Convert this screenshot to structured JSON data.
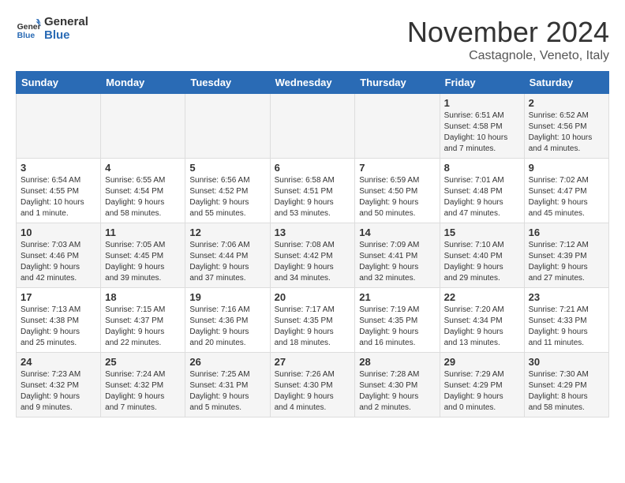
{
  "header": {
    "logo_line1": "General",
    "logo_line2": "Blue",
    "month": "November 2024",
    "location": "Castagnole, Veneto, Italy"
  },
  "weekdays": [
    "Sunday",
    "Monday",
    "Tuesday",
    "Wednesday",
    "Thursday",
    "Friday",
    "Saturday"
  ],
  "weeks": [
    [
      {
        "day": "",
        "info": ""
      },
      {
        "day": "",
        "info": ""
      },
      {
        "day": "",
        "info": ""
      },
      {
        "day": "",
        "info": ""
      },
      {
        "day": "",
        "info": ""
      },
      {
        "day": "1",
        "info": "Sunrise: 6:51 AM\nSunset: 4:58 PM\nDaylight: 10 hours\nand 7 minutes."
      },
      {
        "day": "2",
        "info": "Sunrise: 6:52 AM\nSunset: 4:56 PM\nDaylight: 10 hours\nand 4 minutes."
      }
    ],
    [
      {
        "day": "3",
        "info": "Sunrise: 6:54 AM\nSunset: 4:55 PM\nDaylight: 10 hours\nand 1 minute."
      },
      {
        "day": "4",
        "info": "Sunrise: 6:55 AM\nSunset: 4:54 PM\nDaylight: 9 hours\nand 58 minutes."
      },
      {
        "day": "5",
        "info": "Sunrise: 6:56 AM\nSunset: 4:52 PM\nDaylight: 9 hours\nand 55 minutes."
      },
      {
        "day": "6",
        "info": "Sunrise: 6:58 AM\nSunset: 4:51 PM\nDaylight: 9 hours\nand 53 minutes."
      },
      {
        "day": "7",
        "info": "Sunrise: 6:59 AM\nSunset: 4:50 PM\nDaylight: 9 hours\nand 50 minutes."
      },
      {
        "day": "8",
        "info": "Sunrise: 7:01 AM\nSunset: 4:48 PM\nDaylight: 9 hours\nand 47 minutes."
      },
      {
        "day": "9",
        "info": "Sunrise: 7:02 AM\nSunset: 4:47 PM\nDaylight: 9 hours\nand 45 minutes."
      }
    ],
    [
      {
        "day": "10",
        "info": "Sunrise: 7:03 AM\nSunset: 4:46 PM\nDaylight: 9 hours\nand 42 minutes."
      },
      {
        "day": "11",
        "info": "Sunrise: 7:05 AM\nSunset: 4:45 PM\nDaylight: 9 hours\nand 39 minutes."
      },
      {
        "day": "12",
        "info": "Sunrise: 7:06 AM\nSunset: 4:44 PM\nDaylight: 9 hours\nand 37 minutes."
      },
      {
        "day": "13",
        "info": "Sunrise: 7:08 AM\nSunset: 4:42 PM\nDaylight: 9 hours\nand 34 minutes."
      },
      {
        "day": "14",
        "info": "Sunrise: 7:09 AM\nSunset: 4:41 PM\nDaylight: 9 hours\nand 32 minutes."
      },
      {
        "day": "15",
        "info": "Sunrise: 7:10 AM\nSunset: 4:40 PM\nDaylight: 9 hours\nand 29 minutes."
      },
      {
        "day": "16",
        "info": "Sunrise: 7:12 AM\nSunset: 4:39 PM\nDaylight: 9 hours\nand 27 minutes."
      }
    ],
    [
      {
        "day": "17",
        "info": "Sunrise: 7:13 AM\nSunset: 4:38 PM\nDaylight: 9 hours\nand 25 minutes."
      },
      {
        "day": "18",
        "info": "Sunrise: 7:15 AM\nSunset: 4:37 PM\nDaylight: 9 hours\nand 22 minutes."
      },
      {
        "day": "19",
        "info": "Sunrise: 7:16 AM\nSunset: 4:36 PM\nDaylight: 9 hours\nand 20 minutes."
      },
      {
        "day": "20",
        "info": "Sunrise: 7:17 AM\nSunset: 4:35 PM\nDaylight: 9 hours\nand 18 minutes."
      },
      {
        "day": "21",
        "info": "Sunrise: 7:19 AM\nSunset: 4:35 PM\nDaylight: 9 hours\nand 16 minutes."
      },
      {
        "day": "22",
        "info": "Sunrise: 7:20 AM\nSunset: 4:34 PM\nDaylight: 9 hours\nand 13 minutes."
      },
      {
        "day": "23",
        "info": "Sunrise: 7:21 AM\nSunset: 4:33 PM\nDaylight: 9 hours\nand 11 minutes."
      }
    ],
    [
      {
        "day": "24",
        "info": "Sunrise: 7:23 AM\nSunset: 4:32 PM\nDaylight: 9 hours\nand 9 minutes."
      },
      {
        "day": "25",
        "info": "Sunrise: 7:24 AM\nSunset: 4:32 PM\nDaylight: 9 hours\nand 7 minutes."
      },
      {
        "day": "26",
        "info": "Sunrise: 7:25 AM\nSunset: 4:31 PM\nDaylight: 9 hours\nand 5 minutes."
      },
      {
        "day": "27",
        "info": "Sunrise: 7:26 AM\nSunset: 4:30 PM\nDaylight: 9 hours\nand 4 minutes."
      },
      {
        "day": "28",
        "info": "Sunrise: 7:28 AM\nSunset: 4:30 PM\nDaylight: 9 hours\nand 2 minutes."
      },
      {
        "day": "29",
        "info": "Sunrise: 7:29 AM\nSunset: 4:29 PM\nDaylight: 9 hours\nand 0 minutes."
      },
      {
        "day": "30",
        "info": "Sunrise: 7:30 AM\nSunset: 4:29 PM\nDaylight: 8 hours\nand 58 minutes."
      }
    ]
  ]
}
